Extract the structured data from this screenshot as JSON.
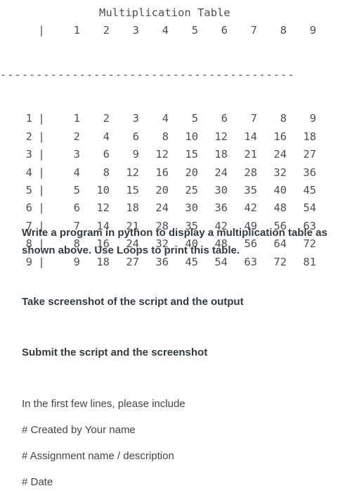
{
  "table": {
    "title": "Multiplication Table",
    "corner": "",
    "pipe": "|",
    "separator": "-----------------------------------------",
    "col_headers": [
      "1",
      "2",
      "3",
      "4",
      "5",
      "6",
      "7",
      "8",
      "9"
    ],
    "row_labels": [
      "1",
      "2",
      "3",
      "4",
      "5",
      "6",
      "7",
      "8",
      "9"
    ],
    "rows": [
      [
        "1",
        "2",
        "3",
        "4",
        "5",
        "6",
        "7",
        "8",
        "9"
      ],
      [
        "2",
        "4",
        "6",
        "8",
        "10",
        "12",
        "14",
        "16",
        "18"
      ],
      [
        "3",
        "6",
        "9",
        "12",
        "15",
        "18",
        "21",
        "24",
        "27"
      ],
      [
        "4",
        "8",
        "12",
        "16",
        "20",
        "24",
        "28",
        "32",
        "36"
      ],
      [
        "5",
        "10",
        "15",
        "20",
        "25",
        "30",
        "35",
        "40",
        "45"
      ],
      [
        "6",
        "12",
        "18",
        "24",
        "30",
        "36",
        "42",
        "48",
        "54"
      ],
      [
        "7",
        "14",
        "21",
        "28",
        "35",
        "42",
        "49",
        "56",
        "63"
      ],
      [
        "8",
        "16",
        "24",
        "32",
        "40",
        "48",
        "56",
        "64",
        "72"
      ],
      [
        "9",
        "18",
        "27",
        "36",
        "45",
        "54",
        "63",
        "72",
        "81"
      ]
    ]
  },
  "instructions": {
    "line1": "Write a program in python to display a multiplication table as",
    "line2": "shown above.  Use Loops to print this table.",
    "line3": "Take screenshot of the script and the output",
    "line4": "Submit the script and the screenshot",
    "line5": "In the first few lines, please include",
    "line6": "# Created by  Your name",
    "line7": "# Assignment name / description",
    "line8": "#  Date"
  },
  "colors": {
    "background": "#ffffff",
    "mono_text": "#4c5055",
    "bold_text": "#343a40",
    "regular_text": "#41464b"
  }
}
